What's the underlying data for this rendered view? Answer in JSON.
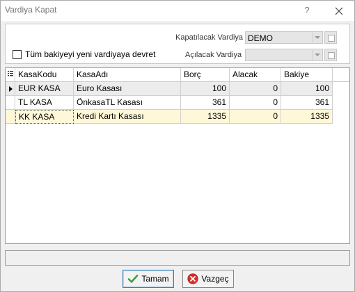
{
  "window": {
    "title": "Vardiya Kapat",
    "help_glyph": "?",
    "close_glyph": "✕"
  },
  "form": {
    "kapatilacak_label": "Kapatılacak Vardiya",
    "kapatilacak_value": "DEMO",
    "acilacak_label": "Açılacak Vardiya",
    "acilacak_value": "",
    "devret_label": "Tüm bakiyeyi yeni vardiyaya devret",
    "devret_checked": false
  },
  "grid": {
    "columns": [
      "KasaKodu",
      "KasaAdı",
      "Borç",
      "Alacak",
      "Bakiye"
    ],
    "rows": [
      {
        "kod": "EUR KASA",
        "ad": "Euro Kasası",
        "borc": "100",
        "alacak": "0",
        "bakiye": "100"
      },
      {
        "kod": "TL KASA",
        "ad": "ÖnkasaTL Kasası",
        "borc": "361",
        "alacak": "0",
        "bakiye": "361"
      },
      {
        "kod": "KK KASA",
        "ad": "Kredi Kartı Kasası",
        "borc": "1335",
        "alacak": "0",
        "bakiye": "1335"
      }
    ]
  },
  "buttons": {
    "ok_label": "Tamam",
    "cancel_label": "Vazgeç"
  },
  "colors": {
    "selected_row": "#fff8d8",
    "current_row": "#ececec",
    "ok_icon": "#3aa43a",
    "cancel_icon": "#d9302b"
  },
  "icons": {
    "ok": "checkmark-icon",
    "cancel": "cancel-x-icon",
    "column_chooser": "column-chooser-icon"
  }
}
